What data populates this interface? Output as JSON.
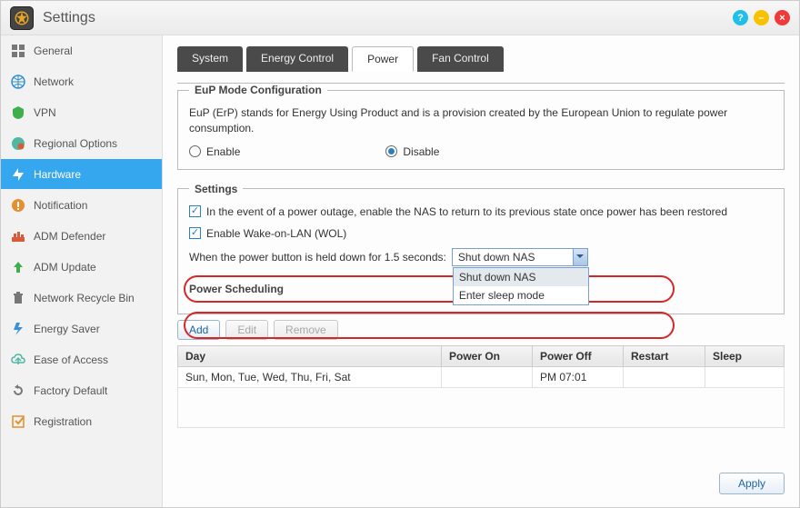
{
  "window": {
    "title": "Settings"
  },
  "winbuttons": {
    "help": "?",
    "min": "–",
    "close": "×"
  },
  "sidebar": {
    "items": [
      {
        "label": "General"
      },
      {
        "label": "Network"
      },
      {
        "label": "VPN"
      },
      {
        "label": "Regional Options"
      },
      {
        "label": "Hardware"
      },
      {
        "label": "Notification"
      },
      {
        "label": "ADM Defender"
      },
      {
        "label": "ADM Update"
      },
      {
        "label": "Network Recycle Bin"
      },
      {
        "label": "Energy Saver"
      },
      {
        "label": "Ease of Access"
      },
      {
        "label": "Factory Default"
      },
      {
        "label": "Registration"
      }
    ]
  },
  "tabs": {
    "system": "System",
    "energy": "Energy Control",
    "power": "Power",
    "fan": "Fan Control"
  },
  "eup": {
    "legend": "EuP Mode Configuration",
    "desc": "EuP (ErP) stands for Energy Using Product and is a provision created by the European Union to regulate power consumption.",
    "enable": "Enable",
    "disable": "Disable",
    "value": "disable"
  },
  "settings": {
    "legend": "Settings",
    "outage": "In the event of a power outage, enable the NAS to return to its previous state once power has been restored",
    "wol": "Enable Wake-on-LAN (WOL)",
    "outage_checked": true,
    "wol_checked": true,
    "pb_label": "When the power button is held down for 1.5 seconds:",
    "pb_value": "Shut down NAS",
    "pb_options": [
      "Shut down NAS",
      "Enter sleep mode"
    ]
  },
  "sched": {
    "legend": "Power Scheduling",
    "add": "Add",
    "edit": "Edit",
    "remove": "Remove",
    "cols": {
      "day": "Day",
      "on": "Power On",
      "off": "Power Off",
      "restart": "Restart",
      "sleep": "Sleep"
    },
    "rows": [
      {
        "day": "Sun, Mon, Tue, Wed, Thu, Fri, Sat",
        "on": "",
        "off": "PM 07:01",
        "restart": "",
        "sleep": ""
      }
    ]
  },
  "apply": "Apply"
}
